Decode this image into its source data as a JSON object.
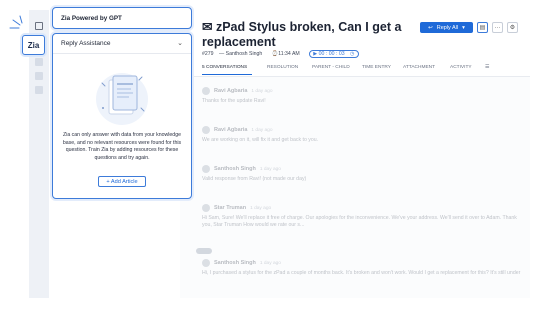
{
  "zia": {
    "badge_label": "Zia",
    "powered_title": "Zia Powered by GPT"
  },
  "reply_panel": {
    "title": "Reply Assistance",
    "message": "Zia can only answer with data from your knowledge base, and no relevant resources were found for this question. Train Zia by adding resources for these questions and try again.",
    "add_button": "+ Add Article"
  },
  "ticket": {
    "title": "zPad Stylus broken, Can I get a replacement",
    "id": "#279",
    "agent": "Santhosh Singh",
    "time": "11:34 AM",
    "timer": "00 : 00 : 03",
    "reply_all_label": "Reply All",
    "more_label": "···",
    "tabs": [
      "5 CONVERSATIONS",
      "RESOLUTION",
      "PARENT - CHILD",
      "TIME ENTRY",
      "ATTACHMENT",
      "ACTIVITY"
    ]
  },
  "conversations": [
    {
      "name": "Ravi Agbaria",
      "time": "1 day ago",
      "body": "Thanks for the update Ravi!"
    },
    {
      "name": "Ravi Agbaria",
      "time": "1 day ago",
      "body": "We are working on it, will fix it and get back to you."
    },
    {
      "name": "Santhosh Singh",
      "time": "1 day ago",
      "body": "Valid response from Ravi! (not made our day)"
    },
    {
      "name": "Star Truman",
      "time": "1 day ago",
      "body": "Hi Sam, Sure! We'll replace it free of charge. Our apologies for the inconvenience. We've your address. We'll send it over to Adam. Thank you, Star Truman How would we rate our s..."
    },
    {
      "name": "Santhosh Singh",
      "time": "1 day ago",
      "body": "Hi, I purchased a stylus for the zPad a couple of months back. It's broken and won't work. Would I get a replacement for this? It's still under"
    }
  ],
  "colors": {
    "accent": "#1f6ad8",
    "panel_border": "#3d7bd9"
  },
  "icons": [
    "book-icon",
    "sparkle-icon",
    "expand-icon",
    "chevron-down-icon",
    "ticket-icon"
  ]
}
